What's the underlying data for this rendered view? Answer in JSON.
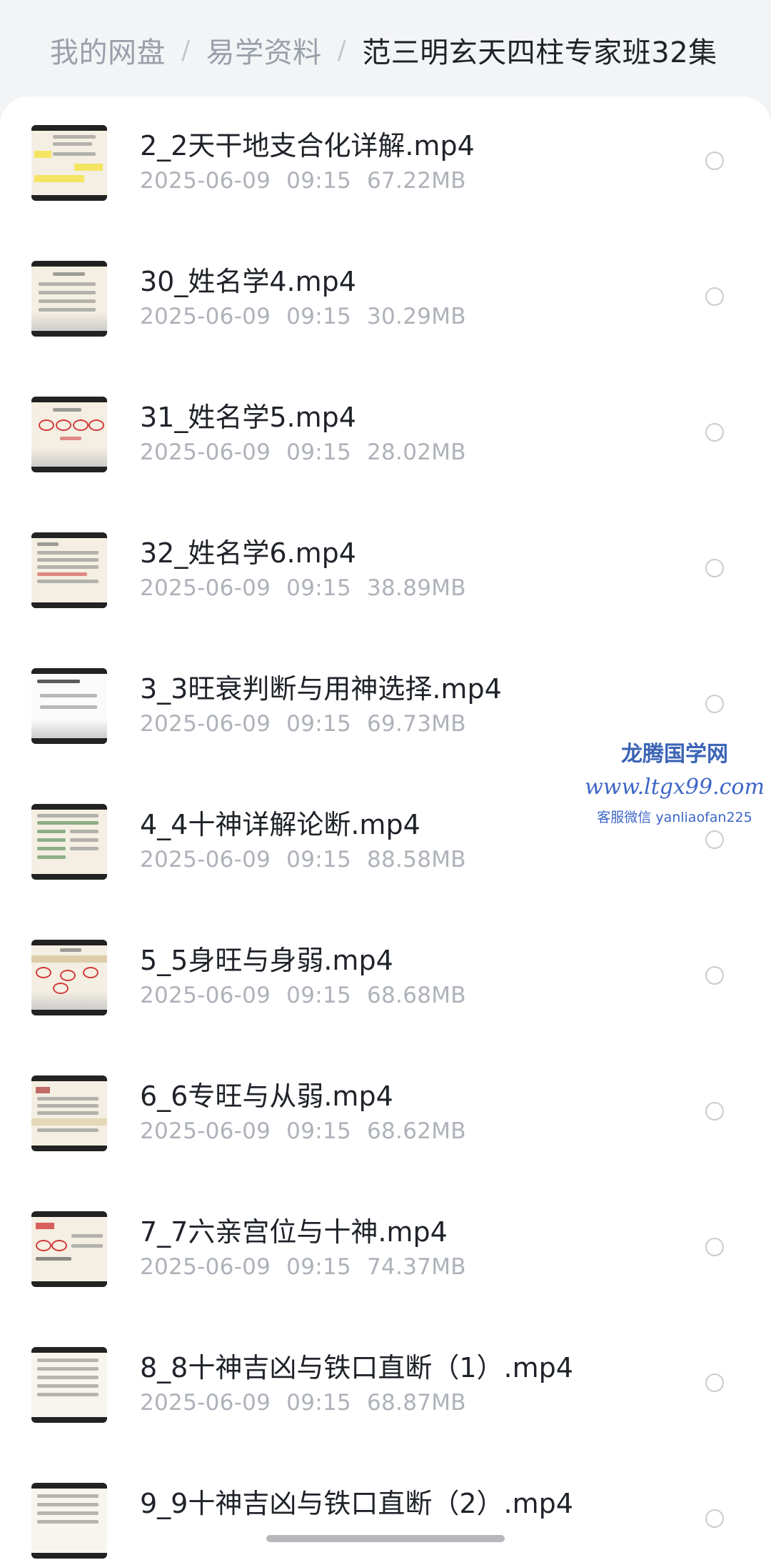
{
  "breadcrumb": {
    "root": "我的网盘",
    "folder": "易学资料",
    "current": "范三明玄天四柱专家班32集"
  },
  "files": [
    {
      "name": "2_2天干地支合化详解.mp4",
      "date": "2025-06-09",
      "time": "09:15",
      "size": "67.22MB"
    },
    {
      "name": "30_姓名学4.mp4",
      "date": "2025-06-09",
      "time": "09:15",
      "size": "30.29MB"
    },
    {
      "name": "31_姓名学5.mp4",
      "date": "2025-06-09",
      "time": "09:15",
      "size": "28.02MB"
    },
    {
      "name": "32_姓名学6.mp4",
      "date": "2025-06-09",
      "time": "09:15",
      "size": "38.89MB"
    },
    {
      "name": "3_3旺衰判断与用神选择.mp4",
      "date": "2025-06-09",
      "time": "09:15",
      "size": "69.73MB"
    },
    {
      "name": "4_4十神详解论断.mp4",
      "date": "2025-06-09",
      "time": "09:15",
      "size": "88.58MB"
    },
    {
      "name": "5_5身旺与身弱.mp4",
      "date": "2025-06-09",
      "time": "09:15",
      "size": "68.68MB"
    },
    {
      "name": "6_6专旺与从弱.mp4",
      "date": "2025-06-09",
      "time": "09:15",
      "size": "68.62MB"
    },
    {
      "name": "7_7六亲宫位与十神.mp4",
      "date": "2025-06-09",
      "time": "09:15",
      "size": "74.37MB"
    },
    {
      "name": "8_8十神吉凶与铁口直断（1）.mp4",
      "date": "2025-06-09",
      "time": "09:15",
      "size": "68.87MB"
    },
    {
      "name": "9_9十神吉凶与铁口直断（2）.mp4",
      "date": "",
      "time": "",
      "size": ""
    }
  ],
  "watermark": {
    "name": "龙腾国学网",
    "url": "www.ltgx99.com",
    "wechat": "客服微信 yanliaofan225"
  }
}
